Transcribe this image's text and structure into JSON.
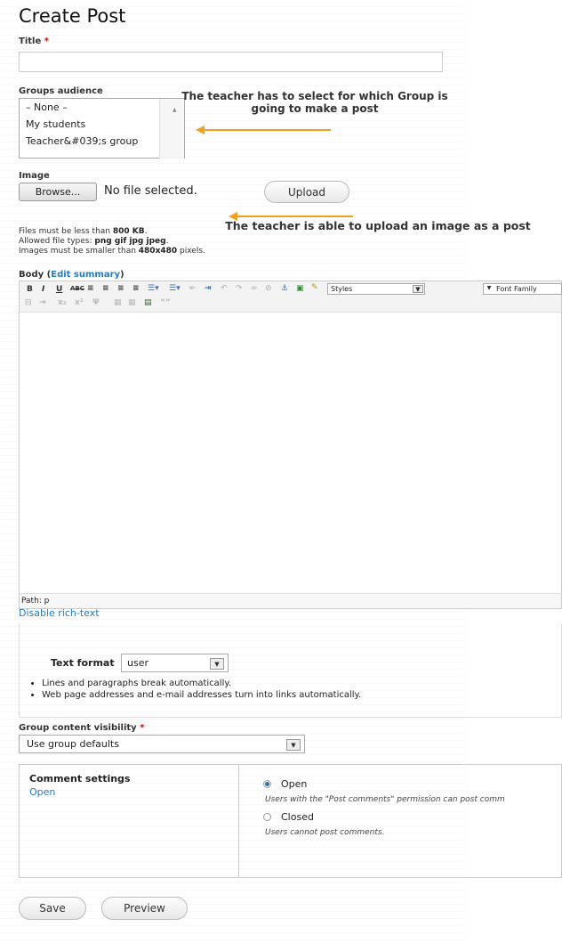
{
  "page": {
    "title": "Create Post"
  },
  "title_field": {
    "label": "Title",
    "required_mark": "*",
    "value": ""
  },
  "groups": {
    "label": "Groups audience",
    "options": [
      "– None –",
      "My students",
      "Teacher&#039;s group"
    ]
  },
  "annotations": {
    "groups_note": "The teacher has to select for which Group is going to make a post",
    "image_note": "The teacher is able to upload an image as a post"
  },
  "image": {
    "label": "Image",
    "browse_label": "Browse...",
    "file_status": "No file selected.",
    "upload_label": "Upload",
    "help_size_prefix": "Files must be less than ",
    "help_size_value": "800 KB",
    "help_size_suffix": ".",
    "help_types_prefix": "Allowed file types: ",
    "help_types_value": "png gif jpg jpeg",
    "help_types_suffix": ".",
    "help_dims_prefix": "Images must be smaller than ",
    "help_dims_value": "480x480",
    "help_dims_suffix": " pixels."
  },
  "body": {
    "label": "Body",
    "edit_summary_link": "Edit summary",
    "styles_select": "Styles",
    "font_family_select": "Font Family",
    "path_label": "Path: p",
    "disable_rich_text": "Disable rich-text"
  },
  "text_format": {
    "label": "Text format",
    "value": "user",
    "tips": [
      "Lines and paragraphs break automatically.",
      "Web page addresses and e-mail addresses turn into links automatically."
    ]
  },
  "visibility": {
    "label": "Group content visibility",
    "required_mark": "*",
    "value": "Use group defaults"
  },
  "comments": {
    "title": "Comment settings",
    "summary": "Open",
    "open_label": "Open",
    "open_desc": "Users with the \"Post comments\" permission can post comm",
    "closed_label": "Closed",
    "closed_desc": "Users cannot post comments.",
    "selected": "Open"
  },
  "actions": {
    "save_label": "Save",
    "preview_label": "Preview"
  },
  "colors": {
    "arrow": "#f0a020",
    "link": "#2b7bb9",
    "required": "#cc0000"
  }
}
